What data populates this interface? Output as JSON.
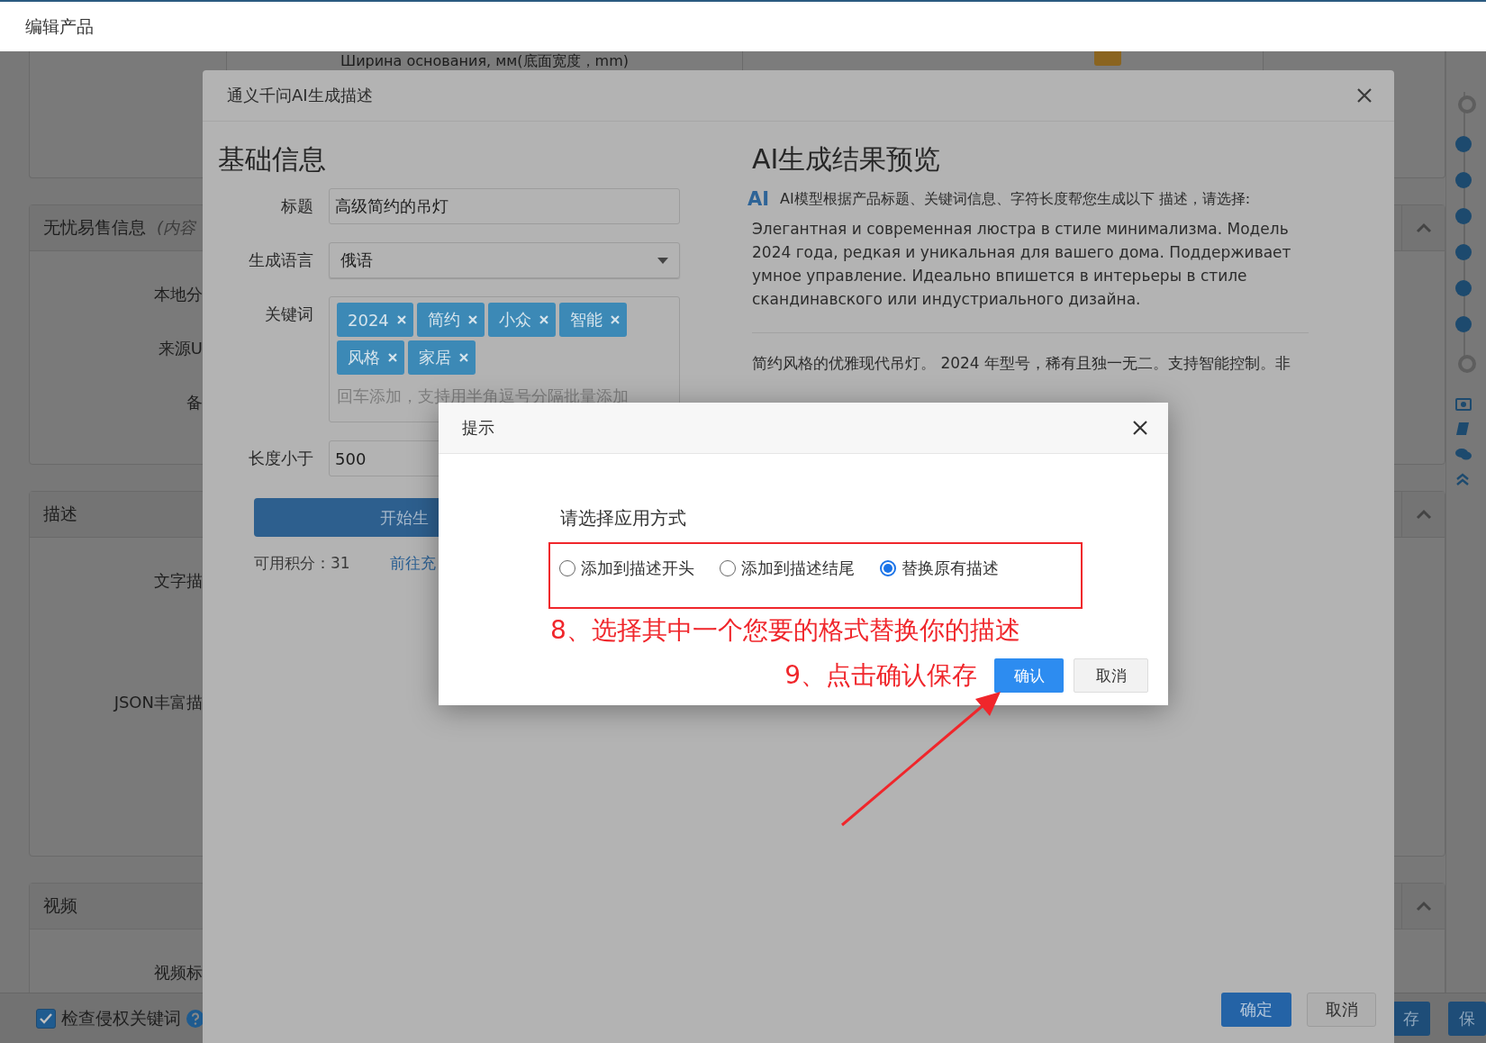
{
  "page_header": {
    "title": "编辑产品"
  },
  "background_page": {
    "top_row_text": "Ширина основания, мм(底面宽度，mm)",
    "panels": [
      {
        "title": "无忧易售信息",
        "note": "(内容",
        "fields": [
          "本地分",
          "来源U",
          "备"
        ]
      },
      {
        "title": "描述",
        "fields": [
          "文字描",
          "JSON丰富描"
        ]
      },
      {
        "title": "视频",
        "fields": [
          "视频标"
        ]
      }
    ],
    "footer": {
      "checkbox": {
        "label": "检查侵权关键词",
        "checked": true
      },
      "buttons": [
        "存",
        "保"
      ]
    }
  },
  "ai_dialog": {
    "title": "通义千问AI生成描述",
    "left": {
      "heading": "基础信息",
      "fields": [
        {
          "kind": "input",
          "label": "标题",
          "value": "高级简约的吊灯"
        },
        {
          "kind": "select",
          "label": "生成语言",
          "value": "俄语"
        }
      ],
      "keywords": {
        "label": "关键词",
        "tags": [
          "2024",
          "简约",
          "小众",
          "智能",
          "风格",
          "家居"
        ],
        "placeholder": "回车添加，支持用半角逗号分隔批量添加"
      },
      "length": {
        "label": "长度小于",
        "value": "500"
      },
      "generate_button": "开始生",
      "points": "可用积分：31",
      "recharge_link": "前往充"
    },
    "right": {
      "heading": "AI生成结果预览",
      "ai_badge": "AI",
      "intro": "AI模型根据产品标题、关键词信息、字符长度帮您生成以下 描述，请选择:",
      "result_ru": "Элегантная и современная люстра в стиле минимализма. Модель 2024 года, редкая и уникальная для вашего дома. Поддерживает умное управление. Идеально впишется в интерьеры в стиле скандинавского или индустриального дизайна.",
      "result_zh": "简约风格的优雅现代吊灯。 2024 年型号，稀有且独一无二。支持智能控制。非"
    },
    "buttons": [
      "确定",
      "取消"
    ]
  },
  "prompt_dialog": {
    "title": "提示",
    "prompt": "请选择应用方式",
    "options": [
      {
        "label": "添加到描述开头",
        "selected": false
      },
      {
        "label": "添加到描述结尾",
        "selected": false
      },
      {
        "label": "替换原有描述",
        "selected": true
      }
    ],
    "confirm": "确认",
    "cancel": "取消"
  },
  "annotations": {
    "step8": "8、选择其中一个您要的格式替换你的描述",
    "step9": "9、点击确认保存"
  }
}
